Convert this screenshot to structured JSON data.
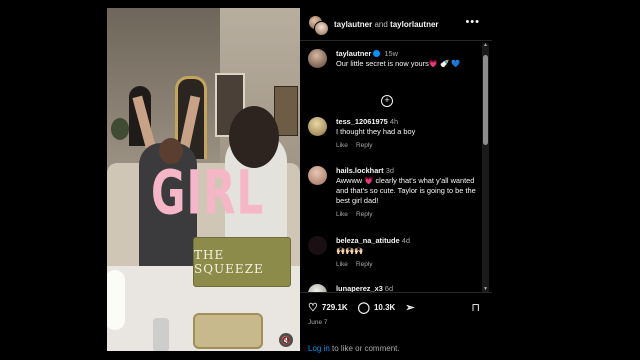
{
  "header": {
    "user1": "taylautner",
    "and": "and",
    "user2": "taylorlautner",
    "more_icon": "more-horizontal-icon"
  },
  "media": {
    "overlay_text": "GIRL",
    "laptop_text": "THE SQUEEZE",
    "mute_icon": "speaker-muted-icon"
  },
  "caption": {
    "user": "taylautner",
    "time": "15w",
    "text": "Our little secret is now yours💗 🍼 💙"
  },
  "comments": [
    {
      "user": "tess_12061975",
      "time": "4h",
      "text": "I thought they had a boy",
      "like": "Like",
      "reply": "Reply"
    },
    {
      "user": "hails.lockhart",
      "time": "3d",
      "text": "Awwww 💗 clearly that's what y'all wanted and that's so cute. Taylor is going to be the best girl dad!",
      "like": "Like",
      "reply": "Reply"
    },
    {
      "user": "beleza_na_atitude",
      "time": "4d",
      "text": "🙌🏻🙌🏻🙌🏻",
      "like": "Like",
      "reply": "Reply"
    },
    {
      "user": "lunaperez_x3",
      "time": "6d",
      "text": "",
      "like": "",
      "reply": ""
    }
  ],
  "actions": {
    "likes": "729.1K",
    "comments": "10.3K",
    "date": "June 7",
    "login_link": "Log in",
    "login_rest": " to like or comment."
  },
  "colors": {
    "accent": "#0095f6",
    "overlay_pink": "#f5b6c7"
  }
}
